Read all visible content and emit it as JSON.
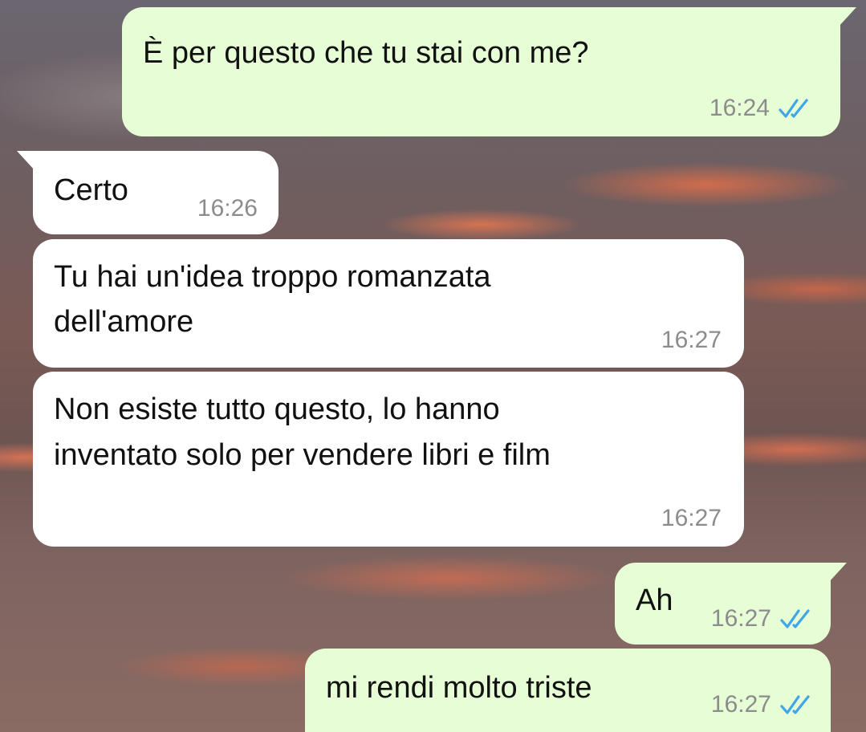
{
  "messages": [
    {
      "direction": "outgoing",
      "text": "È per questo che tu stai con me?",
      "time": "16:24",
      "status": "read"
    },
    {
      "direction": "incoming",
      "text": "Certo",
      "time": "16:26"
    },
    {
      "direction": "incoming",
      "line1": "Tu hai un'idea troppo romanzata",
      "line2": "dell'amore",
      "time": "16:27"
    },
    {
      "direction": "incoming",
      "line1": "Non esiste tutto questo, lo hanno",
      "line2": "inventato solo per vendere libri e film",
      "time": "16:27"
    },
    {
      "direction": "outgoing",
      "text": "Ah",
      "time": "16:27",
      "status": "read"
    },
    {
      "direction": "outgoing",
      "text": "mi rendi molto triste",
      "time": "16:27",
      "status": "read"
    }
  ],
  "colors": {
    "outgoing_bubble": "#e6fdd6",
    "incoming_bubble": "#ffffff",
    "read_ticks": "#3fa6e8",
    "timestamp": "#8c8c8c"
  }
}
